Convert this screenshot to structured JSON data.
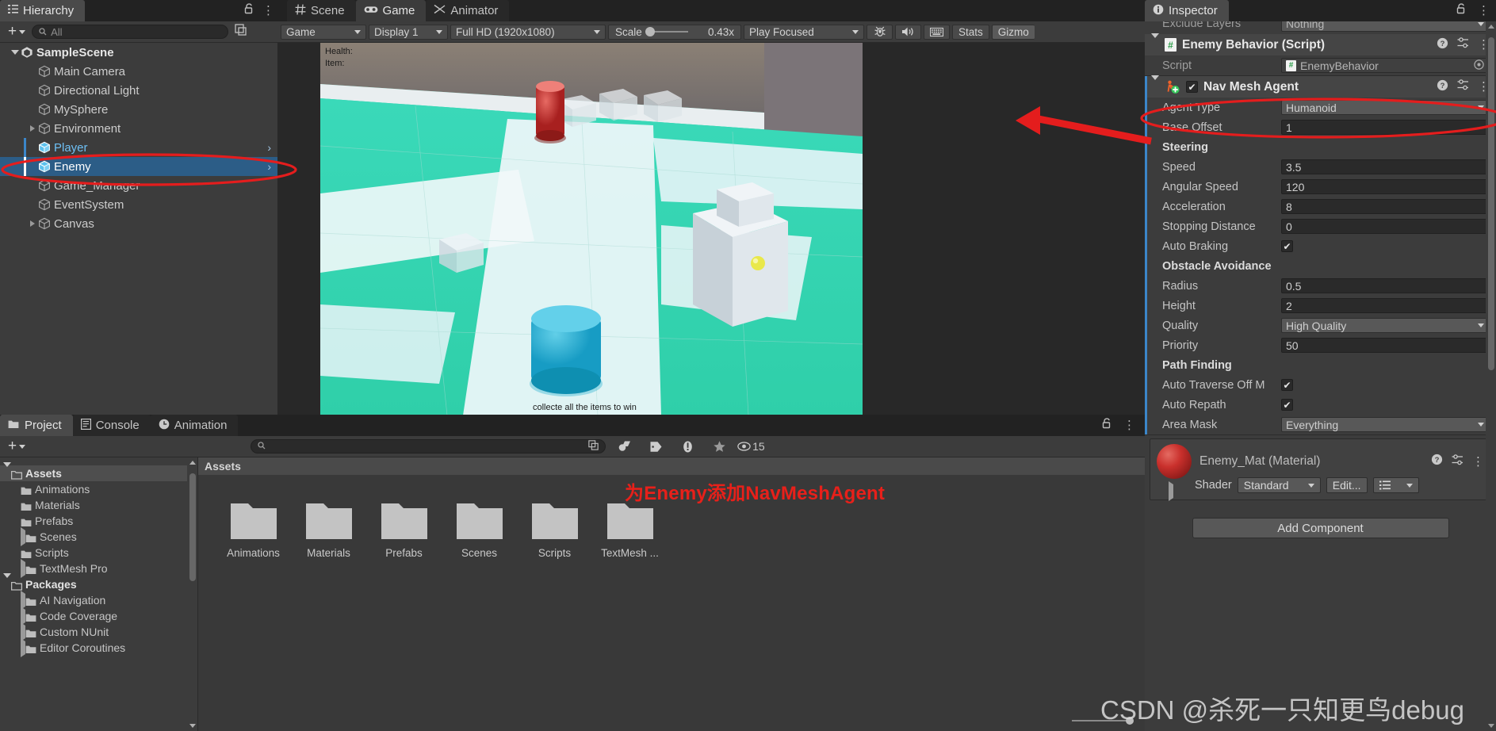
{
  "hierarchy": {
    "tab_label": "Hierarchy",
    "tab_icon": "hierarchy-icon",
    "search_placeholder": "All",
    "items": [
      {
        "label": "SampleScene",
        "depth": 0,
        "kind": "scene",
        "expanded": true,
        "arrow": "down",
        "selected": false,
        "chevron": false
      },
      {
        "label": "Main Camera",
        "depth": 1,
        "kind": "object",
        "expanded": false,
        "arrow": "none",
        "selected": false,
        "chevron": false
      },
      {
        "label": "Directional Light",
        "depth": 1,
        "kind": "object",
        "expanded": false,
        "arrow": "none",
        "selected": false,
        "chevron": false
      },
      {
        "label": "MySphere",
        "depth": 1,
        "kind": "object",
        "expanded": false,
        "arrow": "none",
        "selected": false,
        "chevron": false
      },
      {
        "label": "Environment",
        "depth": 1,
        "kind": "object",
        "expanded": false,
        "arrow": "right",
        "selected": false,
        "chevron": false
      },
      {
        "label": "Player",
        "depth": 1,
        "kind": "prefab",
        "expanded": false,
        "arrow": "none",
        "selected": false,
        "chevron": true
      },
      {
        "label": "Enemy",
        "depth": 1,
        "kind": "prefab",
        "expanded": false,
        "arrow": "none",
        "selected": true,
        "chevron": true
      },
      {
        "label": "Game_Manager",
        "depth": 1,
        "kind": "object",
        "expanded": false,
        "arrow": "none",
        "selected": false,
        "chevron": false
      },
      {
        "label": "EventSystem",
        "depth": 1,
        "kind": "object",
        "expanded": false,
        "arrow": "none",
        "selected": false,
        "chevron": false
      },
      {
        "label": "Canvas",
        "depth": 1,
        "kind": "object",
        "expanded": false,
        "arrow": "right",
        "selected": false,
        "chevron": false
      }
    ]
  },
  "gameview": {
    "tabs": [
      {
        "label": "Scene",
        "icon": "grid-icon",
        "active": false
      },
      {
        "label": "Game",
        "icon": "gamepad-icon",
        "active": true
      },
      {
        "label": "Animator",
        "icon": "animator-icon",
        "active": false
      }
    ],
    "toolbar": {
      "view_mode": "Game",
      "display": "Display 1",
      "resolution": "Full HD (1920x1080)",
      "scale_label": "Scale",
      "scale_value": "0.43x",
      "play_mode": "Play Focused",
      "mute_icon": "speaker-icon",
      "debug_icon": "bug-icon",
      "keyboard_icon": "keyboard-icon",
      "stats_label": "Stats",
      "gizmos_label": "Gizmo"
    },
    "hud": {
      "health": "Health:",
      "item": "Item:"
    },
    "bottom_text": "collecte all the items to win"
  },
  "inspector": {
    "tab_label": "Inspector",
    "tab_icon": "info-icon",
    "clipped_row": {
      "label": "Exclude Layers",
      "value": "Nothing"
    },
    "script_component": {
      "title": "Enemy Behavior (Script)",
      "icon": "csharp-script-icon",
      "script_label": "Script",
      "script_value": "EnemyBehavior"
    },
    "navmesh_component": {
      "title": "Nav Mesh Agent",
      "icon": "navmesh-agent-icon",
      "enabled": true,
      "rows": [
        {
          "label": "Agent Type",
          "value": "Humanoid",
          "type": "dropdown"
        },
        {
          "label": "Base Offset",
          "value": "1",
          "type": "text"
        }
      ],
      "sections": [
        {
          "title": "Steering",
          "rows": [
            {
              "label": "Speed",
              "value": "3.5",
              "type": "text"
            },
            {
              "label": "Angular Speed",
              "value": "120",
              "type": "text"
            },
            {
              "label": "Acceleration",
              "value": "8",
              "type": "text"
            },
            {
              "label": "Stopping Distance",
              "value": "0",
              "type": "text"
            },
            {
              "label": "Auto Braking",
              "value": true,
              "type": "checkbox"
            }
          ]
        },
        {
          "title": "Obstacle Avoidance",
          "rows": [
            {
              "label": "Radius",
              "value": "0.5",
              "type": "text"
            },
            {
              "label": "Height",
              "value": "2",
              "type": "text"
            },
            {
              "label": "Quality",
              "value": "High Quality",
              "type": "dropdown"
            },
            {
              "label": "Priority",
              "value": "50",
              "type": "text"
            }
          ]
        },
        {
          "title": "Path Finding",
          "rows": [
            {
              "label": "Auto Traverse Off M",
              "value": true,
              "type": "checkbox"
            },
            {
              "label": "Auto Repath",
              "value": true,
              "type": "checkbox"
            },
            {
              "label": "Area Mask",
              "value": "Everything",
              "type": "dropdown"
            }
          ]
        }
      ]
    },
    "material": {
      "title": "Enemy_Mat (Material)",
      "shader_label": "Shader",
      "shader_value": "Standard",
      "edit_label": "Edit...",
      "preset_icon": "preset-list-icon"
    },
    "add_component_label": "Add Component"
  },
  "project": {
    "tabs": [
      {
        "label": "Project",
        "icon": "folder-icon",
        "active": true
      },
      {
        "label": "Console",
        "icon": "console-icon",
        "active": false
      },
      {
        "label": "Animation",
        "icon": "clock-icon",
        "active": false
      }
    ],
    "search_placeholder": "",
    "filter_icons": [
      "asset-type-icon",
      "label-icon",
      "warning-icon",
      "favorite-icon"
    ],
    "visible_count": "15",
    "tree": [
      {
        "label": "Assets",
        "depth": 0,
        "arrow": "down",
        "bold": true,
        "selected": true
      },
      {
        "label": "Animations",
        "depth": 1,
        "arrow": "none",
        "bold": false,
        "selected": false
      },
      {
        "label": "Materials",
        "depth": 1,
        "arrow": "none",
        "bold": false,
        "selected": false
      },
      {
        "label": "Prefabs",
        "depth": 1,
        "arrow": "none",
        "bold": false,
        "selected": false
      },
      {
        "label": "Scenes",
        "depth": 1,
        "arrow": "right",
        "bold": false,
        "selected": false
      },
      {
        "label": "Scripts",
        "depth": 1,
        "arrow": "none",
        "bold": false,
        "selected": false
      },
      {
        "label": "TextMesh Pro",
        "depth": 1,
        "arrow": "right",
        "bold": false,
        "selected": false
      },
      {
        "label": "Packages",
        "depth": 0,
        "arrow": "down",
        "bold": true,
        "selected": false
      },
      {
        "label": "AI Navigation",
        "depth": 1,
        "arrow": "right",
        "bold": false,
        "selected": false
      },
      {
        "label": "Code Coverage",
        "depth": 1,
        "arrow": "right",
        "bold": false,
        "selected": false
      },
      {
        "label": "Custom NUnit",
        "depth": 1,
        "arrow": "right",
        "bold": false,
        "selected": false
      },
      {
        "label": "Editor Coroutines",
        "depth": 1,
        "arrow": "right",
        "bold": false,
        "selected": false
      }
    ],
    "breadcrumb": "Assets",
    "grid": [
      {
        "label": "Animations"
      },
      {
        "label": "Materials"
      },
      {
        "label": "Prefabs"
      },
      {
        "label": "Scenes"
      },
      {
        "label": "Scripts"
      },
      {
        "label": "TextMesh ..."
      }
    ]
  },
  "annotations": {
    "chinese_note": "为Enemy添加NavMeshAgent",
    "note_color": "#e8201a",
    "highlight_color": "#e41d1d",
    "watermark": "CSDN @杀死一只知更鸟debug"
  }
}
